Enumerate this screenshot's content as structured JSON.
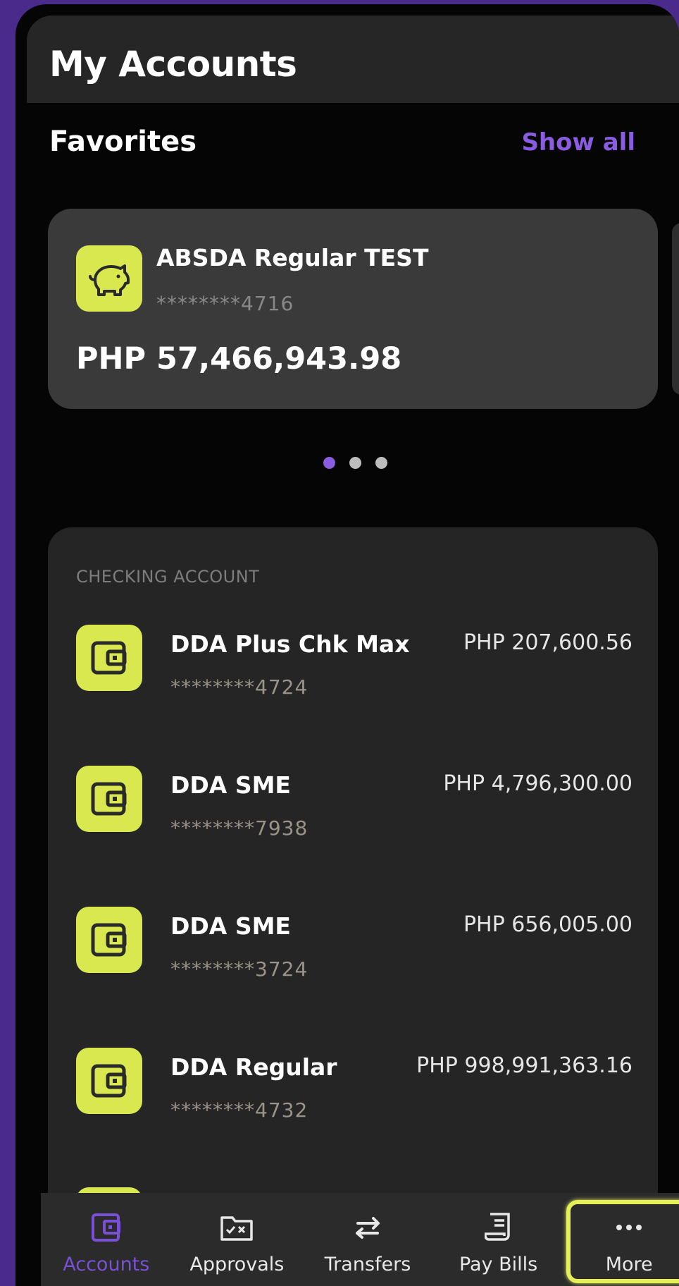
{
  "header": {
    "title": "My Accounts"
  },
  "favorites": {
    "title": "Favorites",
    "show_all": "Show all",
    "card": {
      "icon": "piggy-bank-icon",
      "name": "ABSDA Regular TEST",
      "number": "********4716",
      "balance": "PHP 57,466,943.98"
    },
    "pager": {
      "count": 3,
      "active_index": 0
    }
  },
  "checking": {
    "section_label": "CHECKING ACCOUNT",
    "accounts": [
      {
        "icon": "wallet-icon",
        "name": "DDA Plus Chk Max",
        "number": "********4724",
        "balance": "PHP 207,600.56"
      },
      {
        "icon": "wallet-icon",
        "name": "DDA SME",
        "number": "********7938",
        "balance": "PHP 4,796,300.00"
      },
      {
        "icon": "wallet-icon",
        "name": "DDA SME",
        "number": "********3724",
        "balance": "PHP 656,005.00"
      },
      {
        "icon": "wallet-icon",
        "name": "DDA Regular",
        "number": "********4732",
        "balance": "PHP 998,991,363.16"
      }
    ]
  },
  "tabbar": {
    "tabs": [
      {
        "label": "Accounts",
        "icon": "wallet-icon",
        "active": true
      },
      {
        "label": "Approvals",
        "icon": "approval-folder-icon",
        "active": false
      },
      {
        "label": "Transfers",
        "icon": "transfer-arrows-icon",
        "active": false
      },
      {
        "label": "Pay Bills",
        "icon": "bill-receipt-icon",
        "active": false
      },
      {
        "label": "More",
        "icon": "more-dots-icon",
        "active": false,
        "highlighted": true
      }
    ]
  },
  "colors": {
    "accent_purple": "#8a5ce0",
    "icon_yellow": "#d9e84e",
    "highlight_yellow": "#e4ef5a",
    "background": "#050505",
    "card": "#3a3a3a"
  }
}
